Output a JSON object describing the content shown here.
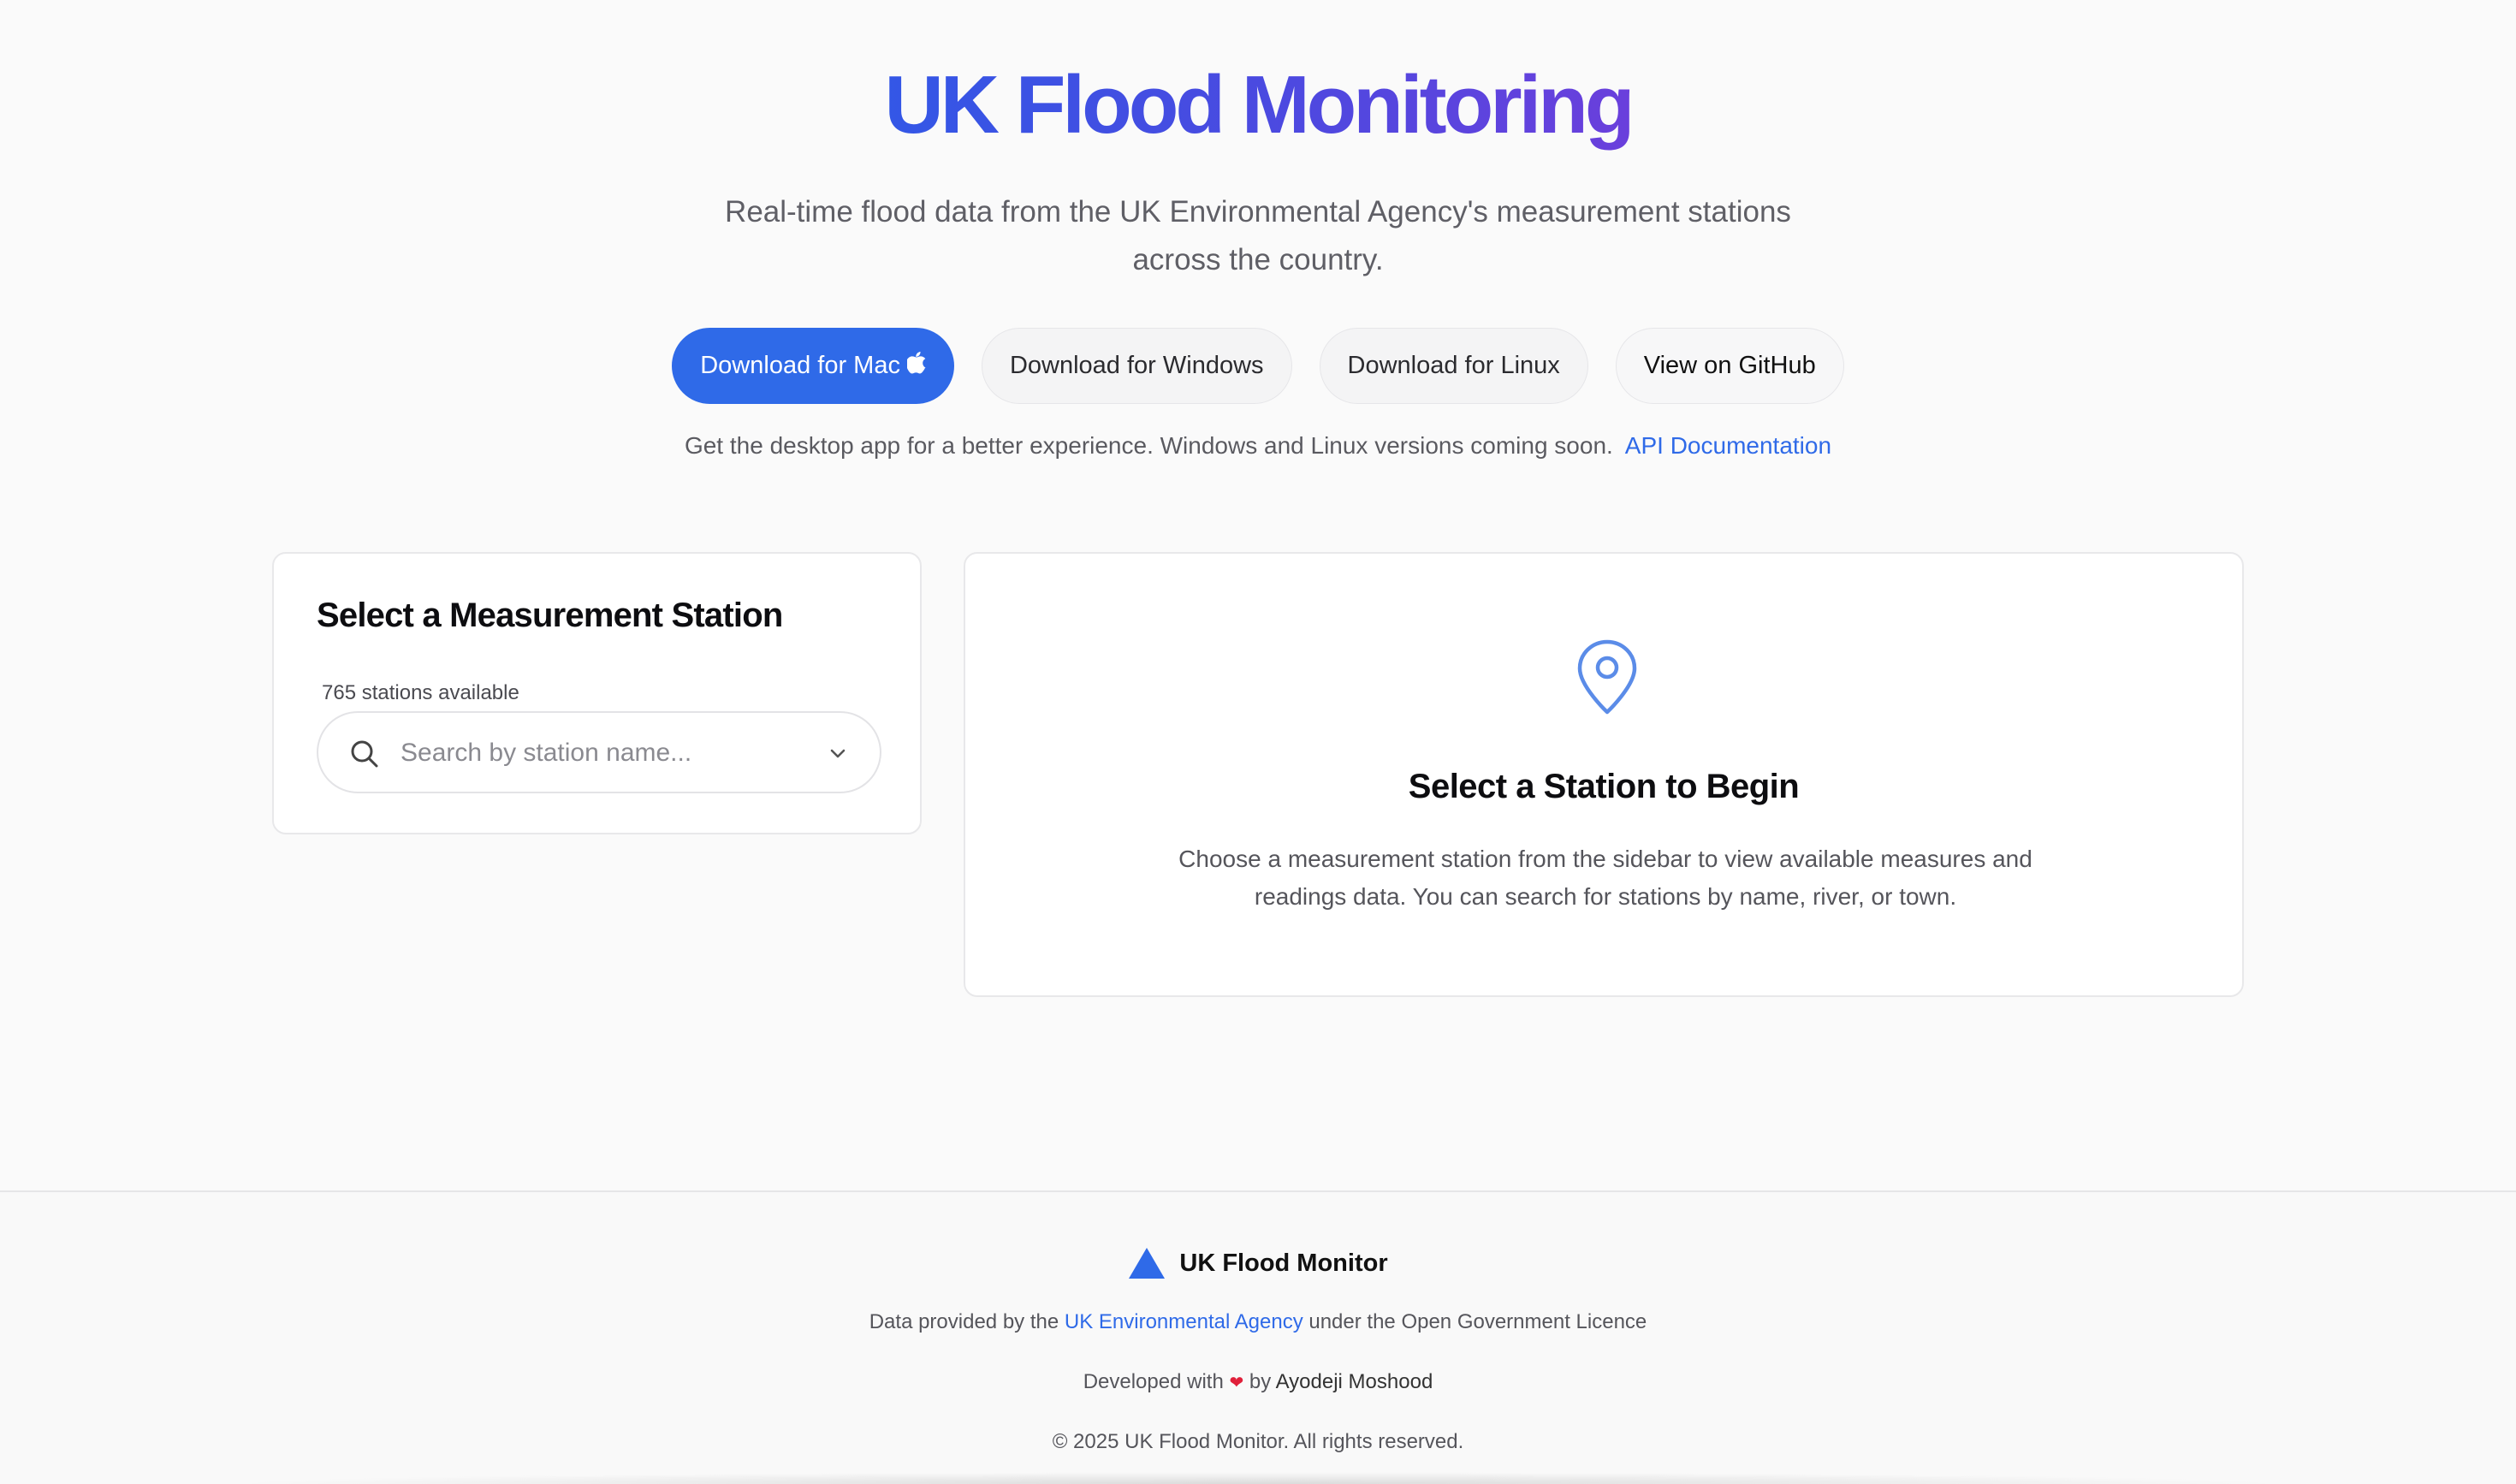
{
  "hero": {
    "title": "UK Flood Monitoring",
    "subtitle": "Real-time flood data from the UK Environmental Agency's measurement stations across the country."
  },
  "buttons": {
    "mac": "Download for Mac",
    "windows": "Download for Windows",
    "linux": "Download for Linux",
    "github": "View on GitHub"
  },
  "info": {
    "text": "Get the desktop app for a better experience. Windows and Linux versions coming soon.",
    "api_link": "API Documentation"
  },
  "sidebar": {
    "title": "Select a Measurement Station",
    "count_label": "765 stations available",
    "search_placeholder": "Search by station name..."
  },
  "main": {
    "empty_title": "Select a Station to Begin",
    "empty_text": "Choose a measurement station from the sidebar to view available measures and readings data. You can search for stations by name, river, or town."
  },
  "footer": {
    "brand": "UK Flood Monitor",
    "data_prefix": "Data provided by the",
    "data_link": "UK Environmental Agency",
    "data_suffix": "under the Open Government Licence",
    "dev_prefix": "Developed with",
    "dev_by": "by",
    "author": "Ayodeji Moshood",
    "copyright": "© 2025 UK Flood Monitor. All rights reserved."
  },
  "colors": {
    "primary": "#2f6ae8",
    "title_gradient_start": "#3357e6",
    "title_gradient_end": "#6a3fdc",
    "heart": "#e0203a"
  },
  "icons": {
    "apple": "apple-icon",
    "search": "search-icon",
    "chevron": "chevron-down-icon",
    "pin": "map-pin-icon",
    "brand": "triangle-icon",
    "heart": "heart-icon"
  }
}
